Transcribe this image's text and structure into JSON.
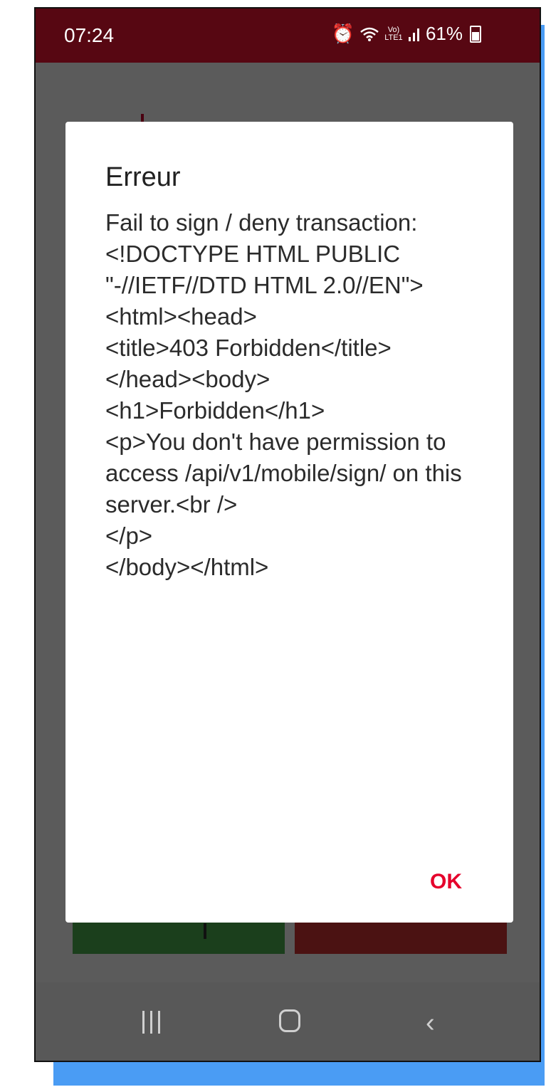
{
  "status_bar": {
    "time": "07:24",
    "network": "Vo) LTE1",
    "battery_percent": "61%",
    "icons": [
      "alarm-icon",
      "wifi-icon",
      "signal-icon",
      "battery-icon"
    ]
  },
  "dialog": {
    "title": "Erreur",
    "message": "Fail to sign / deny transaction: <!DOCTYPE HTML PUBLIC \"-//IETF//DTD HTML 2.0//EN\">\n<html><head>\n<title>403 Forbidden</title>\n</head><body>\n<h1>Forbidden</h1>\n<p>You don't have permission to access /api/v1/mobile/sign/ on this server.<br />\n</p>\n</body></html>",
    "ok_label": "OK"
  },
  "nav_bar": {
    "icons": [
      "recents-icon",
      "home-icon",
      "back-icon"
    ]
  },
  "colors": {
    "status_bar": "#570712",
    "accent": "#e5002b",
    "approve_button": "#1b3f1c",
    "deny_button": "#4b1212",
    "frame_shadow": "#4a9cf4"
  }
}
